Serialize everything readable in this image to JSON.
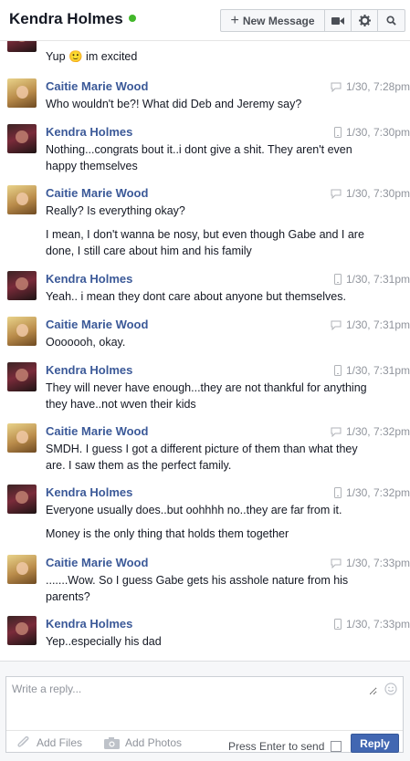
{
  "header": {
    "title": "Kendra Holmes",
    "new_message_label": "New Message"
  },
  "colors": {
    "link_blue": "#3b5998",
    "online_green": "#42b72a",
    "reply_button": "#4267b2",
    "timestamp_gray": "#90949c"
  },
  "messages": [
    {
      "sender": "",
      "time": "",
      "via": "",
      "lines": [
        "Yup 🙂 im excited"
      ]
    },
    {
      "sender": "Caitie Marie Wood",
      "time": "1/30, 7:28pm",
      "via": "web",
      "lines": [
        "Who wouldn't be?! What did Deb and Jeremy say?"
      ]
    },
    {
      "sender": "Kendra Holmes",
      "time": "1/30, 7:30pm",
      "via": "mobile",
      "lines": [
        "Nothing...congrats bout it..i dont give a shit. They aren't even happy themselves"
      ]
    },
    {
      "sender": "Caitie Marie Wood",
      "time": "1/30, 7:30pm",
      "via": "web",
      "lines": [
        "Really? Is everything okay?",
        "I mean, I don't wanna be nosy, but even though Gabe and I are done, I still care about him and his family"
      ]
    },
    {
      "sender": "Kendra Holmes",
      "time": "1/30, 7:31pm",
      "via": "mobile",
      "lines": [
        "Yeah.. i mean they dont care about anyone but themselves."
      ]
    },
    {
      "sender": "Caitie Marie Wood",
      "time": "1/30, 7:31pm",
      "via": "web",
      "lines": [
        "Ooooooh, okay."
      ]
    },
    {
      "sender": "Kendra Holmes",
      "time": "1/30, 7:31pm",
      "via": "mobile",
      "lines": [
        "They will never have enough...they are not thankful for anything they have..not wven their kids"
      ]
    },
    {
      "sender": "Caitie Marie Wood",
      "time": "1/30, 7:32pm",
      "via": "web",
      "lines": [
        "SMDH. I guess I got a different picture of them than what they are. I saw them as the perfect family."
      ]
    },
    {
      "sender": "Kendra Holmes",
      "time": "1/30, 7:32pm",
      "via": "mobile",
      "lines": [
        "Everyone usually does..but oohhhh no..they are far from it.",
        "Money is the only thing that holds them together"
      ]
    },
    {
      "sender": "Caitie Marie Wood",
      "time": "1/30, 7:33pm",
      "via": "web",
      "lines": [
        ".......Wow. So I guess Gabe gets his asshole nature from his parents?"
      ]
    },
    {
      "sender": "Kendra Holmes",
      "time": "1/30, 7:33pm",
      "via": "mobile",
      "lines": [
        "Yep..especially his dad"
      ]
    }
  ],
  "composer": {
    "placeholder": "Write a reply...",
    "add_files": "Add Files",
    "add_photos": "Add Photos",
    "press_enter": "Press Enter to send",
    "reply": "Reply"
  }
}
